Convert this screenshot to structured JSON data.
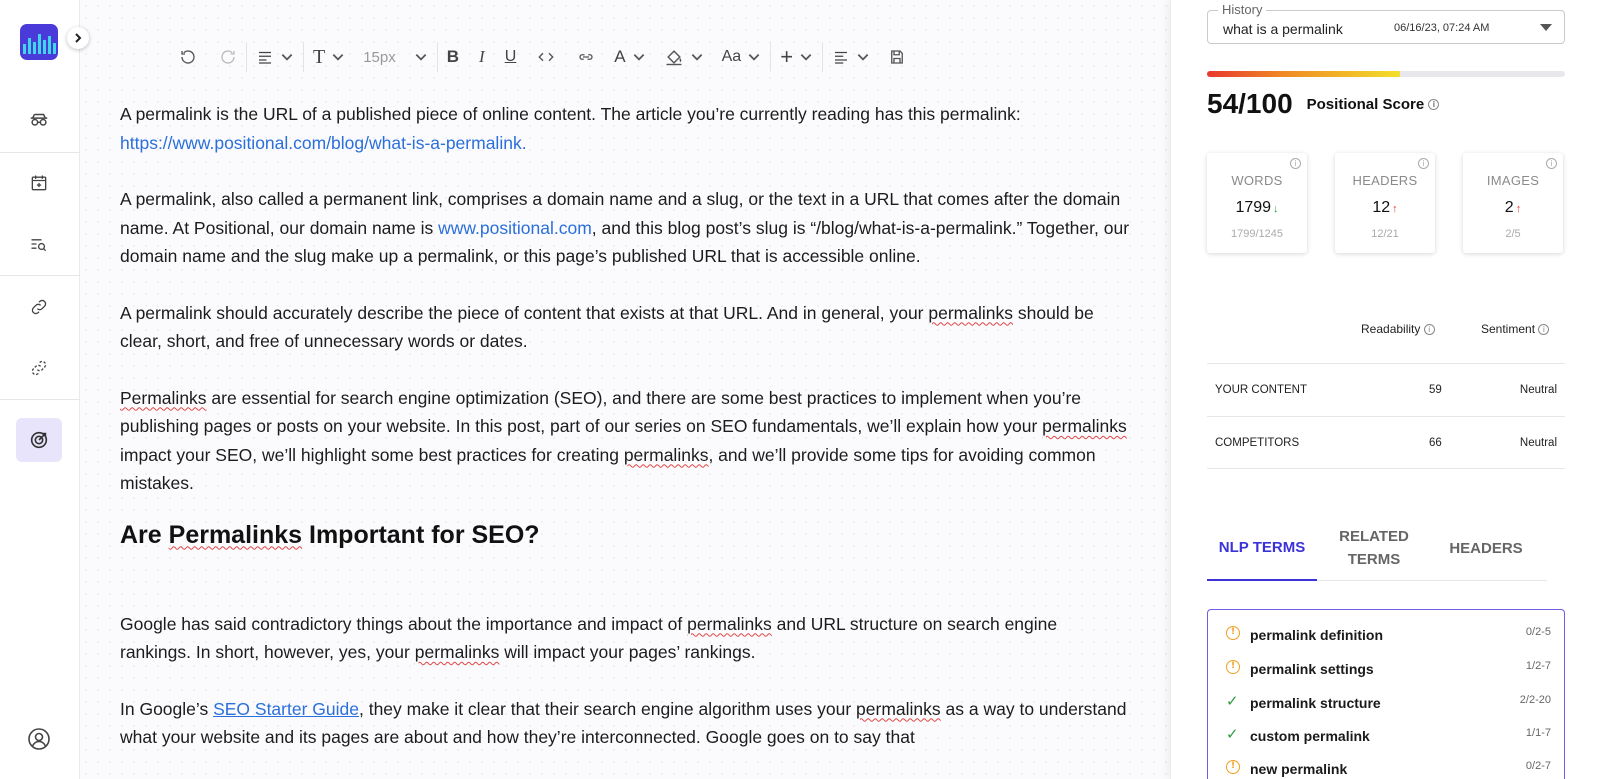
{
  "toolbar": {
    "font_size": "15px",
    "text_style": "T",
    "text_color": "A",
    "case_style": "Aa",
    "insert": "+"
  },
  "article": {
    "p1": "A permalink is the URL of a published piece of online content. The article you’re currently reading has this permalink:",
    "p1_link": "https://www.positional.com/blog/what-is-a-permalink.",
    "p2_a": "A permalink, also called a permanent link, comprises a domain name and a slug, or the text in a URL that comes after the domain name. At Positional, our domain name is ",
    "p2_link": "www.positional.com",
    "p2_b": ", and this blog post’s slug is “/blog/what-is-a-permalink.” Together, our domain name and the slug make up a permalink, or this page’s published URL that is accessible online.",
    "p3_a": "A permalink should accurately describe the piece of content that exists at that URL. And in general, your ",
    "p3_word": "permalinks",
    "p3_b": " should be clear, short, and free of unnecessary words or dates.",
    "p4_word1": "Permalinks",
    "p4_a": " are essential for search engine optimization (SEO), and there are some best practices to implement when you’re publishing pages or posts on your website. In this post, part of our series on SEO fundamentals, we’ll explain how your ",
    "p4_word2": "permalinks",
    "p4_b": " impact your SEO, we’ll highlight some best practices for creating ",
    "p4_word3": "permalinks",
    "p4_c": ", and we’ll provide some tips for avoiding common mistakes.",
    "h2_a": "Are ",
    "h2_word": "Permalinks",
    "h2_b": " Important for SEO?",
    "p5_a": "Google has said contradictory things about the importance and impact of ",
    "p5_word1": "permalinks",
    "p5_b": " and URL structure on search engine rankings. In short, however, yes, your ",
    "p5_word2": "permalinks",
    "p5_c": " will impact your pages’ rankings.",
    "p6_a": "In Google’s ",
    "p6_link": "SEO Starter Guide",
    "p6_b": ", they make it clear that their search engine algorithm uses your ",
    "p6_word": "permalinks",
    "p6_c": " as a way to understand what your website and its pages are about and how they’re interconnected. Google goes on to say that"
  },
  "history": {
    "label": "History",
    "value": "what is a permalink",
    "date": "06/16/23, 07:24 AM"
  },
  "score": {
    "value": "54/100",
    "label": "Positional Score",
    "fraction": 0.54
  },
  "cards": [
    {
      "title": "WORDS",
      "value": "1799",
      "trend": "↓",
      "sub": "1799/1245"
    },
    {
      "title": "HEADERS",
      "value": "12",
      "trend": "↑",
      "sub": "12/21"
    },
    {
      "title": "IMAGES",
      "value": "2",
      "trend": "↑",
      "sub": "2/5"
    }
  ],
  "metrics": {
    "readability_label": "Readability",
    "sentiment_label": "Sentiment",
    "rows": [
      {
        "label": "YOUR CONTENT",
        "readability": "59",
        "sentiment": "Neutral"
      },
      {
        "label": "COMPETITORS",
        "readability": "66",
        "sentiment": "Neutral"
      }
    ]
  },
  "tabs": [
    {
      "label": "NLP TERMS"
    },
    {
      "label": "RELATED TERMS"
    },
    {
      "label": "HEADERS"
    }
  ],
  "terms": [
    {
      "name": "permalink definition",
      "ratio": "0/2-5",
      "status": "warning"
    },
    {
      "name": "permalink settings",
      "ratio": "1/2-7",
      "status": "warning"
    },
    {
      "name": "permalink structure",
      "ratio": "2/2-20",
      "status": "ok"
    },
    {
      "name": "custom permalink",
      "ratio": "1/1-7",
      "status": "ok"
    },
    {
      "name": "new permalink",
      "ratio": "0/2-7",
      "status": "warning"
    }
  ],
  "colors": {
    "accent": "#3b32d9",
    "link": "#2a6fdb",
    "warning": "#f0a020",
    "success": "#2e9e3e"
  }
}
